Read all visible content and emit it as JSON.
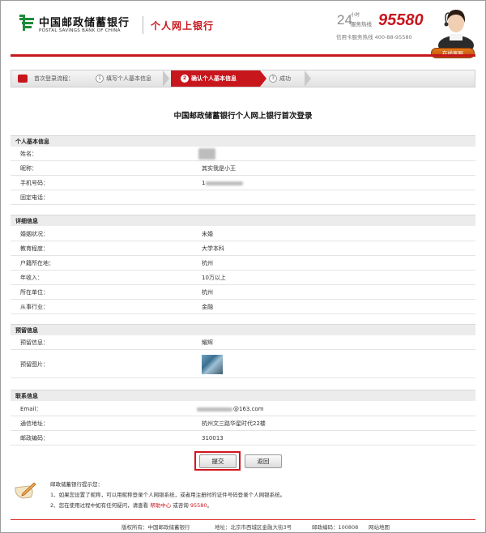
{
  "header": {
    "bank_name_cn": "中国邮政储蓄银行",
    "bank_name_en": "POSTAL SAVINGS BANK OF CHINA",
    "system_title": "个人网上银行",
    "hotline_24": "24",
    "hotline_24_sub": "小时",
    "hotline_label": "服务热线",
    "hotline_number": "95580",
    "card_hotline": "信用卡服务热线  400-88-95580",
    "online_service": "在线客服"
  },
  "steps": {
    "label": "首次登录流程：",
    "items": [
      {
        "num": "1",
        "label": "填写个人基本信息"
      },
      {
        "num": "2",
        "label": "确认个人基本信息"
      },
      {
        "num": "3",
        "label": "成功"
      }
    ]
  },
  "page_title": "中国邮政储蓄银行个人网上银行首次登录",
  "sections": {
    "basic": {
      "title": "个人基本信息",
      "rows": [
        {
          "key": "姓名：",
          "value": ""
        },
        {
          "key": "昵称：",
          "value": "其实我是小王"
        },
        {
          "key": "手机号码：",
          "value": "1"
        },
        {
          "key": "固定电话：",
          "value": ""
        }
      ]
    },
    "detail": {
      "title": "详细信息",
      "rows": [
        {
          "key": "婚姻状况：",
          "value": "未婚"
        },
        {
          "key": "教育程度：",
          "value": "大学本科"
        },
        {
          "key": "户籍所在地：",
          "value": "杭州"
        },
        {
          "key": "年收入：",
          "value": "10万以上"
        },
        {
          "key": "所在单位：",
          "value": "杭州"
        },
        {
          "key": "从事行业：",
          "value": "金融"
        }
      ]
    },
    "reserved": {
      "title": "预留信息",
      "rows": [
        {
          "key": "预留信息：",
          "value": "耀辉"
        },
        {
          "key": "预留图片：",
          "value": ""
        }
      ]
    },
    "contact": {
      "title": "联系信息",
      "rows": [
        {
          "key": "Email：",
          "value": "@163.com"
        },
        {
          "key": "通信地址：",
          "value": "杭州文三路华星时代22楼"
        },
        {
          "key": "邮政编码：",
          "value": "310013"
        }
      ]
    }
  },
  "buttons": {
    "submit": "提交",
    "back": "返回"
  },
  "tips": {
    "title": "邮政储蓄银行提示您：",
    "line1": "1、如果您设置了昵称，可以用昵称登录个人网银系统，或者用注册时的证件号码登录个人网银系统。",
    "line2_pre": "2、您在使用过程中如有任何疑问，请查看",
    "help_link": "帮助中心",
    "line2_mid": "或咨询",
    "line2_num": "95580",
    "line2_end": "。"
  },
  "footer": {
    "copyright": "版权所有：中国邮政储蓄银行",
    "address": "地址：北京市西城区金融大街3号",
    "postcode": "邮政编码：100808",
    "sitemap": "网站地图"
  },
  "colors": {
    "brand_red": "#c8161d",
    "brand_green": "#1f8a3a"
  }
}
